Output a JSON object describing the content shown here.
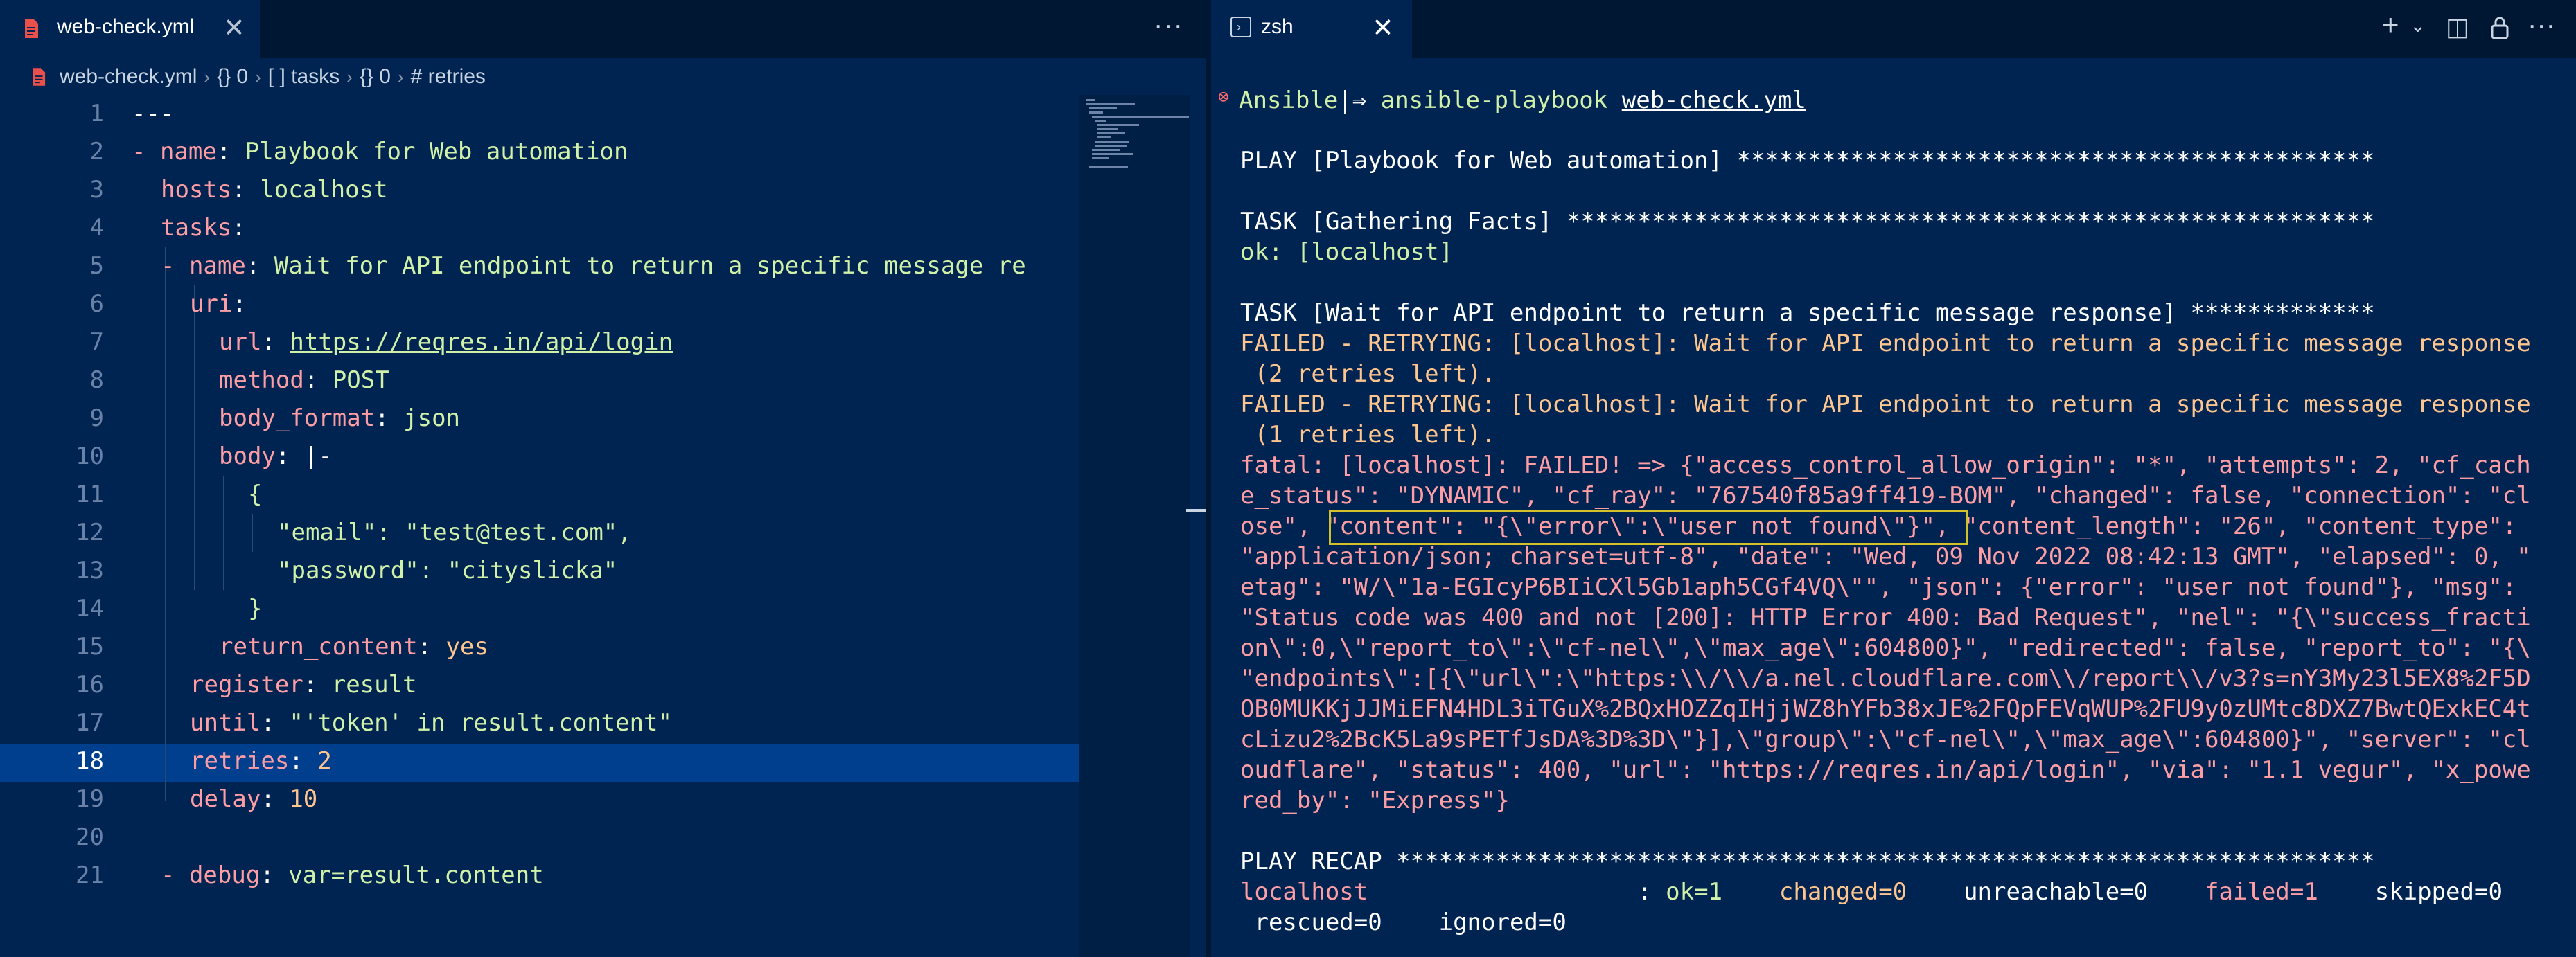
{
  "editor": {
    "tab": {
      "filename": "web-check.yml",
      "close": "✕"
    },
    "more": "···",
    "breadcrumb": [
      "web-check.yml",
      "{} 0",
      "[ ] tasks",
      "{} 0",
      "# retries"
    ],
    "line_numbers": [
      "1",
      "2",
      "3",
      "4",
      "5",
      "6",
      "7",
      "8",
      "9",
      "10",
      "11",
      "12",
      "13",
      "14",
      "15",
      "16",
      "17",
      "18",
      "19",
      "20",
      "21"
    ],
    "current_line": "18",
    "lines": {
      "l1": "---",
      "l2_dash": "- ",
      "l2_key": "name",
      "l2_val": "Playbook for Web automation",
      "l3_key": "hosts",
      "l3_val": "localhost",
      "l4_key": "tasks",
      "l5_dash": "- ",
      "l5_key": "name",
      "l5_val": "Wait for API endpoint to return a specific message re",
      "l6_key": "uri",
      "l7_key": "url",
      "l7_val": "https://reqres.in/api/login",
      "l8_key": "method",
      "l8_val": "POST",
      "l9_key": "body_format",
      "l9_val": "json",
      "l10_key": "body",
      "l10_val": "|-",
      "l11": "{",
      "l12": "\"email\": \"test@test.com\",",
      "l13": "\"password\": \"cityslicka\"",
      "l14": "}",
      "l15_key": "return_content",
      "l15_val": "yes",
      "l16_key": "register",
      "l16_val": "result",
      "l17_key": "until",
      "l17_val": "\"'token' in result.content\"",
      "l18_key": "retries",
      "l18_val": "2",
      "l19_key": "delay",
      "l19_val": "10",
      "l21_dash": "- ",
      "l21_key": "debug",
      "l21_val": "var=result.content"
    }
  },
  "terminal": {
    "tab": {
      "name": "zsh",
      "close": "✕"
    },
    "actions": {
      "new": "+",
      "chevron": "⌄",
      "split": "◫",
      "lock": "🔒",
      "more": "···"
    },
    "prompt": {
      "dir": "Ansible",
      "sep": "|⇒",
      "cmd": "ansible-playbook",
      "arg": "web-check.yml"
    },
    "lines": [
      "PLAY [Playbook for Web automation] *********************************************",
      "TASK [Gathering Facts] *********************************************************",
      "ok: [localhost]",
      "TASK [Wait for API endpoint to return a specific message response] *************",
      "FAILED - RETRYING: [localhost]: Wait for API endpoint to return a specific message response",
      " (2 retries left).",
      "FAILED - RETRYING: [localhost]: Wait for API endpoint to return a specific message response",
      " (1 retries left).",
      "fatal: [localhost]: FAILED! => {\"access_control_allow_origin\": \"*\", \"attempts\": 2, \"cf_cach",
      "e_status\": \"DYNAMIC\", \"cf_ray\": \"767540f85a9ff419-BOM\", \"changed\": false, \"connection\": \"cl",
      "ose\", \"content\": \"{\\\"error\\\":\\\"user not found\\\"}\", \"content_length\": \"26\", \"content_type\":",
      "\"application/json; charset=utf-8\", \"date\": \"Wed, 09 Nov 2022 08:42:13 GMT\", \"elapsed\": 0, \"",
      "etag\": \"W/\\\"1a-EGIcyP6BIiCXl5Gb1aph5CGf4VQ\\\"\", \"json\": {\"error\": \"user not found\"}, \"msg\":",
      "\"Status code was 400 and not [200]: HTTP Error 400: Bad Request\", \"nel\": \"{\\\"success_fracti",
      "on\\\":0,\\\"report_to\\\":\\\"cf-nel\\\",\\\"max_age\\\":604800}\", \"redirected\": false, \"report_to\": \"{\\",
      "\"endpoints\\\":[{\\\"url\\\":\\\"https:\\\\/\\\\/a.nel.cloudflare.com\\\\/report\\\\/v3?s=nY3My23l5EX8%2F5D",
      "OB0MUKKjJJMiEFN4HDL3iTGuX%2BQxHOZZqIHjjWZ8hYFb38xJE%2FQpFEVqWUP%2FU9y0zUMtc8DXZ7BwtQExkEC4t",
      "cLizu2%2BcK5La9sPETfJsDA%3D%3D\\\"}],\\\"group\\\":\\\"cf-nel\\\",\\\"max_age\\\":604800}\", \"server\": \"cl",
      "oudflare\", \"status\": 400, \"url\": \"https://reqres.in/api/login\", \"via\": \"1.1 vegur\", \"x_powe",
      "red_by\": \"Express\"}",
      "PLAY RECAP *********************************************************************"
    ],
    "recap": {
      "host": "localhost",
      "colon": ": ",
      "ok": "ok=1",
      "changed": "changed=0",
      "unreachable": "unreachable=0",
      "failed": "failed=1",
      "skipped": "skipped=0",
      "rescued": "rescued=0",
      "ignored": "ignored=0"
    }
  }
}
